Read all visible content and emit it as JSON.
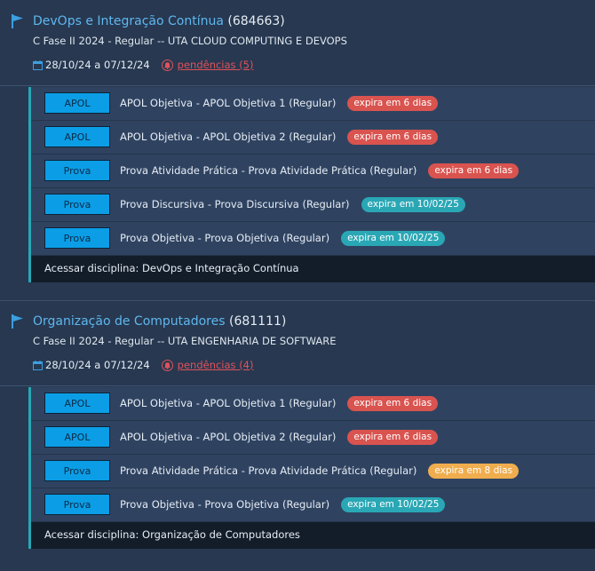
{
  "colors": {
    "background": "#273850",
    "title_link": "#5fb7ef",
    "pending_red": "#e0525b",
    "accent_teal": "#26a8b4",
    "tag_blue": "#0b9ee6",
    "badge_red": "#d9534f",
    "badge_teal": "#2aa7b5",
    "badge_orange": "#f0ad4e"
  },
  "courses": [
    {
      "name": "DevOps e Integração Contínua",
      "code": "(684663)",
      "subtitle": "C Fase II 2024 - Regular -- UTA CLOUD COMPUTING E DEVOPS",
      "dates": "28/10/24 a 07/12/24",
      "pending": "pendências (5)",
      "activities": [
        {
          "tag": "APOL",
          "label": "APOL Objetiva - APOL Objetiva 1 (Regular)",
          "badge": "expira em 6 dias",
          "badge_color": "#d9534f"
        },
        {
          "tag": "APOL",
          "label": "APOL Objetiva - APOL Objetiva 2 (Regular)",
          "badge": "expira em 6 dias",
          "badge_color": "#d9534f"
        },
        {
          "tag": "Prova",
          "label": "Prova Atividade Prática - Prova Atividade Prática (Regular)",
          "badge": "expira em 6 dias",
          "badge_color": "#d9534f"
        },
        {
          "tag": "Prova",
          "label": "Prova Discursiva - Prova Discursiva (Regular)",
          "badge": "expira em 10/02/25",
          "badge_color": "#2aa7b5"
        },
        {
          "tag": "Prova",
          "label": "Prova Objetiva - Prova Objetiva (Regular)",
          "badge": "expira em 10/02/25",
          "badge_color": "#2aa7b5"
        }
      ],
      "access_label": "Acessar disciplina: DevOps e Integração Contínua"
    },
    {
      "name": "Organização de Computadores",
      "code": "(681111)",
      "subtitle": "C Fase II 2024 - Regular -- UTA ENGENHARIA DE SOFTWARE",
      "dates": "28/10/24 a 07/12/24",
      "pending": "pendências (4)",
      "activities": [
        {
          "tag": "APOL",
          "label": "APOL Objetiva - APOL Objetiva 1 (Regular)",
          "badge": "expira em 6 dias",
          "badge_color": "#d9534f"
        },
        {
          "tag": "APOL",
          "label": "APOL Objetiva - APOL Objetiva 2 (Regular)",
          "badge": "expira em 6 dias",
          "badge_color": "#d9534f"
        },
        {
          "tag": "Prova",
          "label": "Prova Atividade Prática - Prova Atividade Prática (Regular)",
          "badge": "expira em 8 dias",
          "badge_color": "#f0ad4e"
        },
        {
          "tag": "Prova",
          "label": "Prova Objetiva - Prova Objetiva (Regular)",
          "badge": "expira em 10/02/25",
          "badge_color": "#2aa7b5"
        }
      ],
      "access_label": "Acessar disciplina: Organização de Computadores"
    }
  ]
}
